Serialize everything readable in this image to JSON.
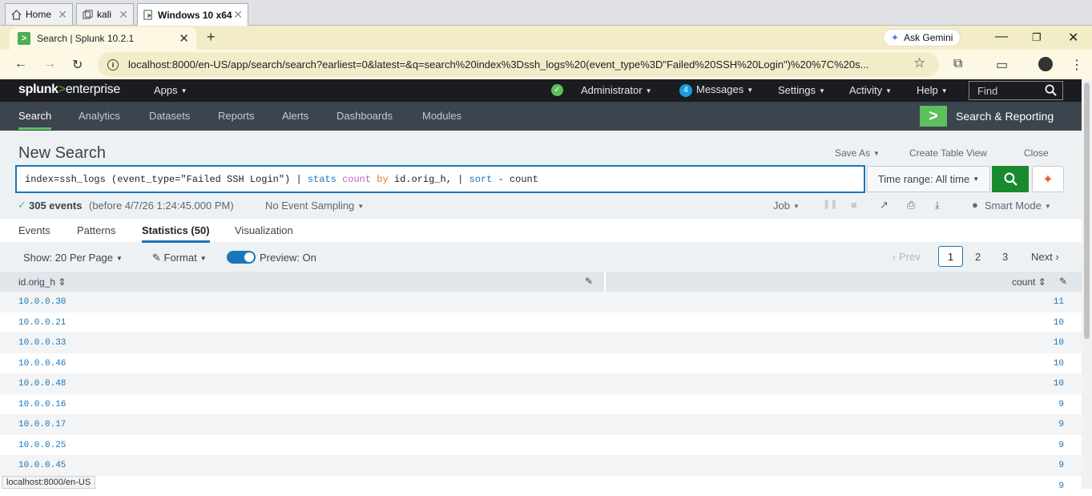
{
  "vm_tabs": [
    {
      "label": "Home"
    },
    {
      "label": "kali"
    },
    {
      "label": "Windows 10 x64"
    }
  ],
  "browser": {
    "tab_title": "Search | Splunk 10.2.1",
    "favicon": ">",
    "new_tab": "+",
    "gemini_label": "Ask Gemini",
    "url": "localhost:8000/en-US/app/search/search?earliest=0&latest=&q=search%20index%3Dssh_logs%20(event_type%3D\"Failed%20SSH%20Login\")%20%7C%20s...",
    "status_url": "localhost:8000/en-US"
  },
  "splunk_top": {
    "logo_main": "splunk",
    "logo_gt": ">",
    "logo_sub": "enterprise",
    "apps": "Apps",
    "user": "Administrator",
    "messages_count": "4",
    "messages": "Messages",
    "settings": "Settings",
    "activity": "Activity",
    "help": "Help",
    "find_placeholder": "Find"
  },
  "app_bar": {
    "tabs": [
      "Search",
      "Analytics",
      "Datasets",
      "Reports",
      "Alerts",
      "Dashboards",
      "Modules"
    ],
    "app_name": "Search & Reporting"
  },
  "search": {
    "title": "New Search",
    "save_as": "Save As",
    "create_table": "Create Table View",
    "close": "Close",
    "q_part1": "index=ssh_logs (event_type=\"Failed SSH Login\") | ",
    "q_stats": "stats",
    "q_count": " count ",
    "q_by": "by",
    "q_part2": " id.orig_h, | ",
    "q_sort": "sort",
    "q_part3": " - count",
    "time_range": "Time range: All time"
  },
  "status": {
    "events": "305 events",
    "before": "(before 4/7/26 1:24:45.000 PM)",
    "sampling": "No Event Sampling",
    "job": "Job",
    "mode": "Smart Mode"
  },
  "result_tabs": [
    "Events",
    "Patterns",
    "Statistics (50)",
    "Visualization"
  ],
  "options": {
    "show": "Show: 20 Per Page",
    "format": "Format",
    "preview": "Preview: On",
    "prev": "Prev",
    "pages": [
      "1",
      "2",
      "3"
    ],
    "next": "Next"
  },
  "table": {
    "col1": "id.orig_h",
    "col2": "count",
    "rows": [
      {
        "ip": "10.0.0.30",
        "count": "11"
      },
      {
        "ip": "10.0.0.21",
        "count": "10"
      },
      {
        "ip": "10.0.0.33",
        "count": "10"
      },
      {
        "ip": "10.0.0.46",
        "count": "10"
      },
      {
        "ip": "10.0.0.48",
        "count": "10"
      },
      {
        "ip": "10.0.0.16",
        "count": "9"
      },
      {
        "ip": "10.0.0.17",
        "count": "9"
      },
      {
        "ip": "10.0.0.25",
        "count": "9"
      },
      {
        "ip": "10.0.0.45",
        "count": "9"
      },
      {
        "ip": "",
        "count": "9"
      }
    ]
  },
  "colors": {
    "accent_green": "#5cc05c",
    "link_blue": "#1a76b9",
    "nav_dark": "#1a1c20",
    "app_bar": "#3c444d"
  }
}
